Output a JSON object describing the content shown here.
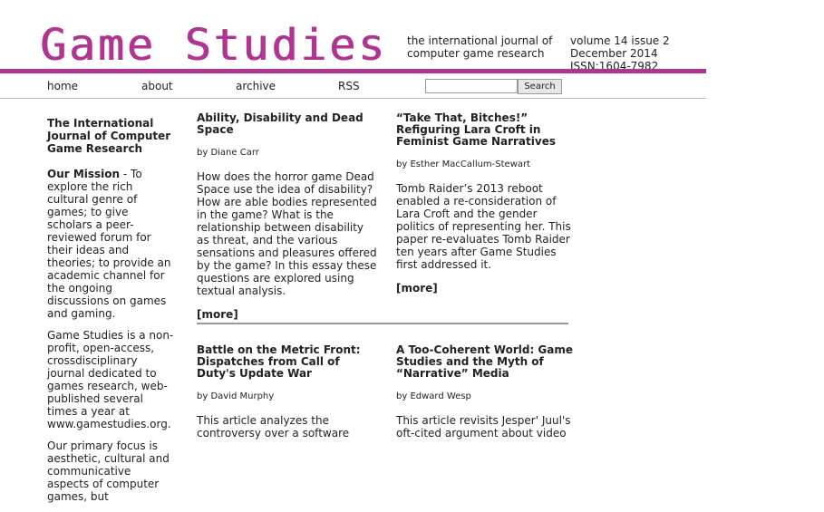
{
  "header": {
    "logo": "Game Studies",
    "tagline": "the international journal of computer game research",
    "issue_line1": "volume 14 issue 2",
    "issue_line2": "December 2014",
    "issue_line3": "ISSN:1604-7982",
    "brand_color": "#b03591"
  },
  "nav": {
    "home": "home",
    "about": "about",
    "archive": "archive",
    "rss": "RSS",
    "search_button": "Search",
    "search_value": ""
  },
  "sidebar": {
    "title": "The International Journal of Computer Game Research",
    "mission_head": "Our Mission",
    "mission_text": " - To explore the rich cultural genre of games; to give scholars a peer-reviewed forum for their ideas and theories; to provide an academic channel for the ongoing discussions on games and gaming.",
    "para2": "Game Studies is a non-profit, open-access, crossdisciplinary journal dedicated to games research, web-published several times a year at www.gamestudies.org.",
    "para3": "Our primary focus is aesthetic, cultural and communicative aspects of computer games, but"
  },
  "articles": [
    {
      "title": "Ability, Disability and Dead Space",
      "author": "by Diane Carr",
      "abstract": "How does the horror game Dead Space use the idea of disability? How are able bodies represented in the game? What is the relationship between disability as threat, and the various sensations and pleasures offered by the game? In this essay these questions are explored using textual analysis.",
      "more": "[more]"
    },
    {
      "title": "“Take That, Bitches!” Refiguring Lara Croft in Feminist Game Narratives",
      "author": "by Esther MacCallum-Stewart",
      "abstract": "Tomb Raider’s 2013 reboot enabled a re-consideration of Lara Croft and the gender politics of representing her. This paper re-evaluates Tomb Raider ten years after Game Studies first addressed it.",
      "more": "[more]"
    },
    {
      "title": "Battle on the Metric Front: Dispatches from Call of Duty's Update War",
      "author": "by David Murphy",
      "abstract": "This article analyzes the controversy over a software",
      "more": ""
    },
    {
      "title": "A Too-Coherent World: Game Studies and the Myth of “Narrative” Media",
      "author": "by Edward Wesp",
      "abstract": "This article revisits Jesper' Juul's oft-cited argument about video",
      "more": ""
    }
  ]
}
